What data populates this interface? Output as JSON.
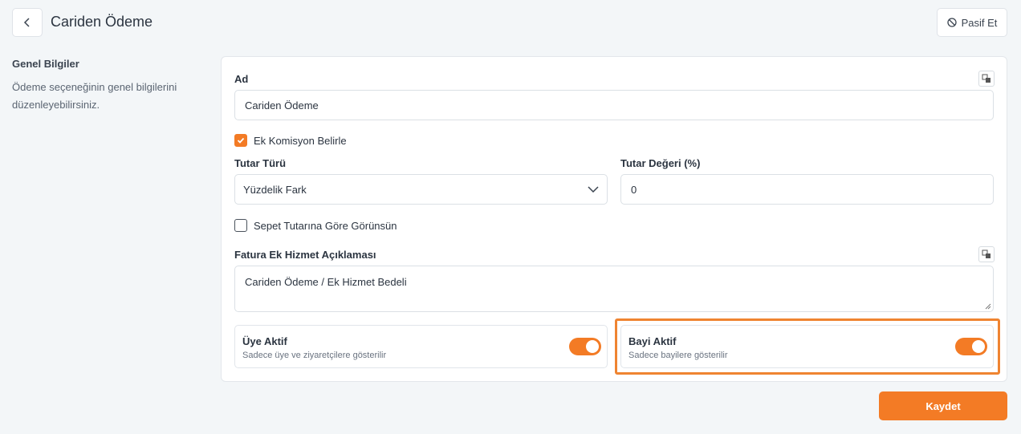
{
  "header": {
    "title": "Cariden Ödeme",
    "deactivate_label": "Pasif Et"
  },
  "sidebar": {
    "title": "Genel Bilgiler",
    "description": "Ödeme seçeneğinin genel bilgilerini düzenleyebilirsiniz."
  },
  "form": {
    "name": {
      "label": "Ad",
      "value": "Cariden Ödeme"
    },
    "extra_commission": {
      "label": "Ek Komisyon Belirle",
      "checked": true
    },
    "amount_type": {
      "label": "Tutar Türü",
      "value": "Yüzdelik Fark"
    },
    "amount_value": {
      "label": "Tutar Değeri (%)",
      "value": "0"
    },
    "cart_total": {
      "label": "Sepet Tutarına Göre Görünsün",
      "checked": false
    },
    "invoice_desc": {
      "label": "Fatura Ek Hizmet Açıklaması",
      "value": "Cariden Ödeme / Ek Hizmet Bedeli"
    },
    "member_active": {
      "title": "Üye Aktif",
      "subtitle": "Sadece üye ve ziyaretçilere gösterilir",
      "on": true
    },
    "dealer_active": {
      "title": "Bayi Aktif",
      "subtitle": "Sadece bayilere gösterilir",
      "on": true
    }
  },
  "footer": {
    "save_label": "Kaydet"
  },
  "colors": {
    "accent": "#f37b25",
    "highlight": "#ef8431",
    "background": "#f3f6f8"
  },
  "icons": {
    "back": "chevron-left-icon",
    "deactivate": "ban-icon",
    "translate": "translate-icon",
    "select": "chevron-down-icon",
    "check": "check-icon"
  }
}
